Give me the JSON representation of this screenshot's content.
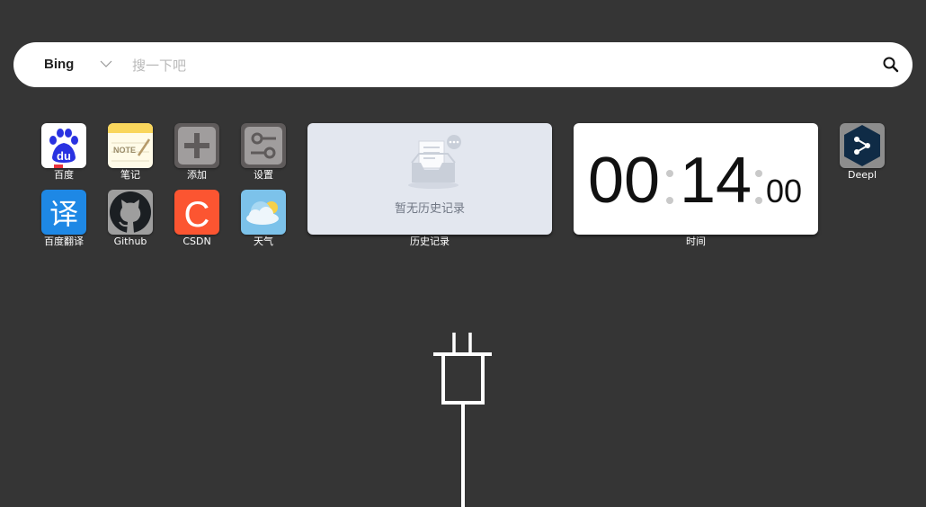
{
  "search": {
    "engine": "Bing",
    "placeholder": "搜一下吧",
    "value": ""
  },
  "shortcuts": [
    {
      "label": "百度",
      "icon": "baidu-icon"
    },
    {
      "label": "笔记",
      "icon": "notes-icon"
    },
    {
      "label": "添加",
      "icon": "add-icon"
    },
    {
      "label": "设置",
      "icon": "settings-icon"
    },
    {
      "label": "百度翻译",
      "icon": "baidu-translate-icon"
    },
    {
      "label": "Github",
      "icon": "github-icon"
    },
    {
      "label": "CSDN",
      "icon": "csdn-icon"
    },
    {
      "label": "天气",
      "icon": "weather-icon"
    }
  ],
  "history_widget": {
    "label": "历史记录",
    "empty_text": "暂无历史记录"
  },
  "clock_widget": {
    "label": "时间",
    "hours": "00",
    "minutes": "14",
    "seconds": "00"
  },
  "deepl": {
    "label": "Deepl",
    "icon": "deepl-icon"
  },
  "colors": {
    "background": "#353535",
    "history_card": "#e3e7ef",
    "clock_card": "#ffffff",
    "baidu_blue": "#2932e1",
    "csdn_red": "#fc5531",
    "translate_blue": "#1e88e5"
  }
}
